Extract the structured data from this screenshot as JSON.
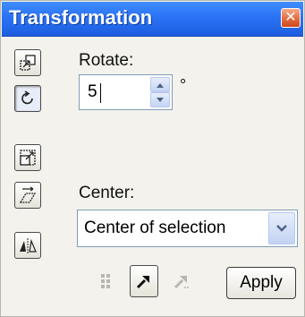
{
  "window": {
    "title": "Transformation",
    "close_symbol": "✕"
  },
  "side_toolbar": [
    {
      "icon": "position-icon",
      "active": false
    },
    {
      "icon": "rotate-icon",
      "active": true
    },
    {
      "icon": "scale-icon",
      "active": false
    },
    {
      "icon": "skew-icon",
      "active": false
    },
    {
      "icon": "mirror-icon",
      "active": false
    }
  ],
  "rotate": {
    "label": "Rotate:",
    "value": "5",
    "unit": "°"
  },
  "center": {
    "label": "Center:",
    "selected": "Center of selection"
  },
  "bottom_toolbar": [
    {
      "icon": "copy-icon",
      "enabled": false
    },
    {
      "icon": "apply-to-object-icon",
      "enabled": true
    },
    {
      "icon": "apply-to-copy-icon",
      "enabled": false
    }
  ],
  "apply_label": "Apply",
  "colors": {
    "titlebar": "#2a72f5",
    "close_button": "#e2663b",
    "panel_bg": "#f3f2ec",
    "field_border": "#7f9db9"
  }
}
